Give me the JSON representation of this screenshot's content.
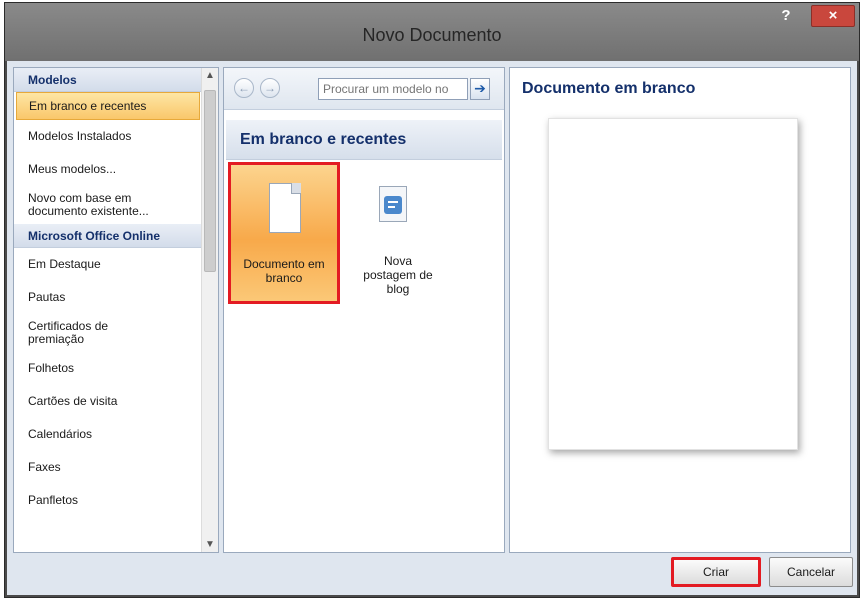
{
  "window": {
    "title": "Novo Documento",
    "help_label": "?",
    "close_label": "×"
  },
  "sidebar": {
    "header": "Modelos",
    "items": [
      {
        "label": "Em branco e recentes",
        "selected": true
      },
      {
        "label": "Modelos Instalados"
      },
      {
        "label": "Meus modelos..."
      },
      {
        "label": "Novo com base em documento existente..."
      }
    ],
    "online_header": "Microsoft Office Online",
    "online_items": [
      {
        "label": "Em Destaque"
      },
      {
        "label": "Pautas"
      },
      {
        "label": "Certificados de premiação"
      },
      {
        "label": "Folhetos"
      },
      {
        "label": "Cartões de visita"
      },
      {
        "label": "Calendários"
      },
      {
        "label": "Faxes"
      },
      {
        "label": "Panfletos"
      }
    ]
  },
  "toolbar": {
    "back_label": "←",
    "forward_label": "→",
    "search_placeholder": "Procurar um modelo no",
    "search_go_label": "➔"
  },
  "section": {
    "heading": "Em branco e recentes"
  },
  "templates": [
    {
      "label": "Documento em branco",
      "selected": true
    },
    {
      "label": "Nova postagem de blog"
    }
  ],
  "preview": {
    "title": "Documento em branco"
  },
  "buttons": {
    "create_label": "Criar",
    "cancel_label": "Cancelar"
  },
  "colors": {
    "highlight_border": "#e31b23",
    "selection_fill": "#fac76b",
    "heading_text": "#14306b",
    "close_button": "#c9473d"
  }
}
